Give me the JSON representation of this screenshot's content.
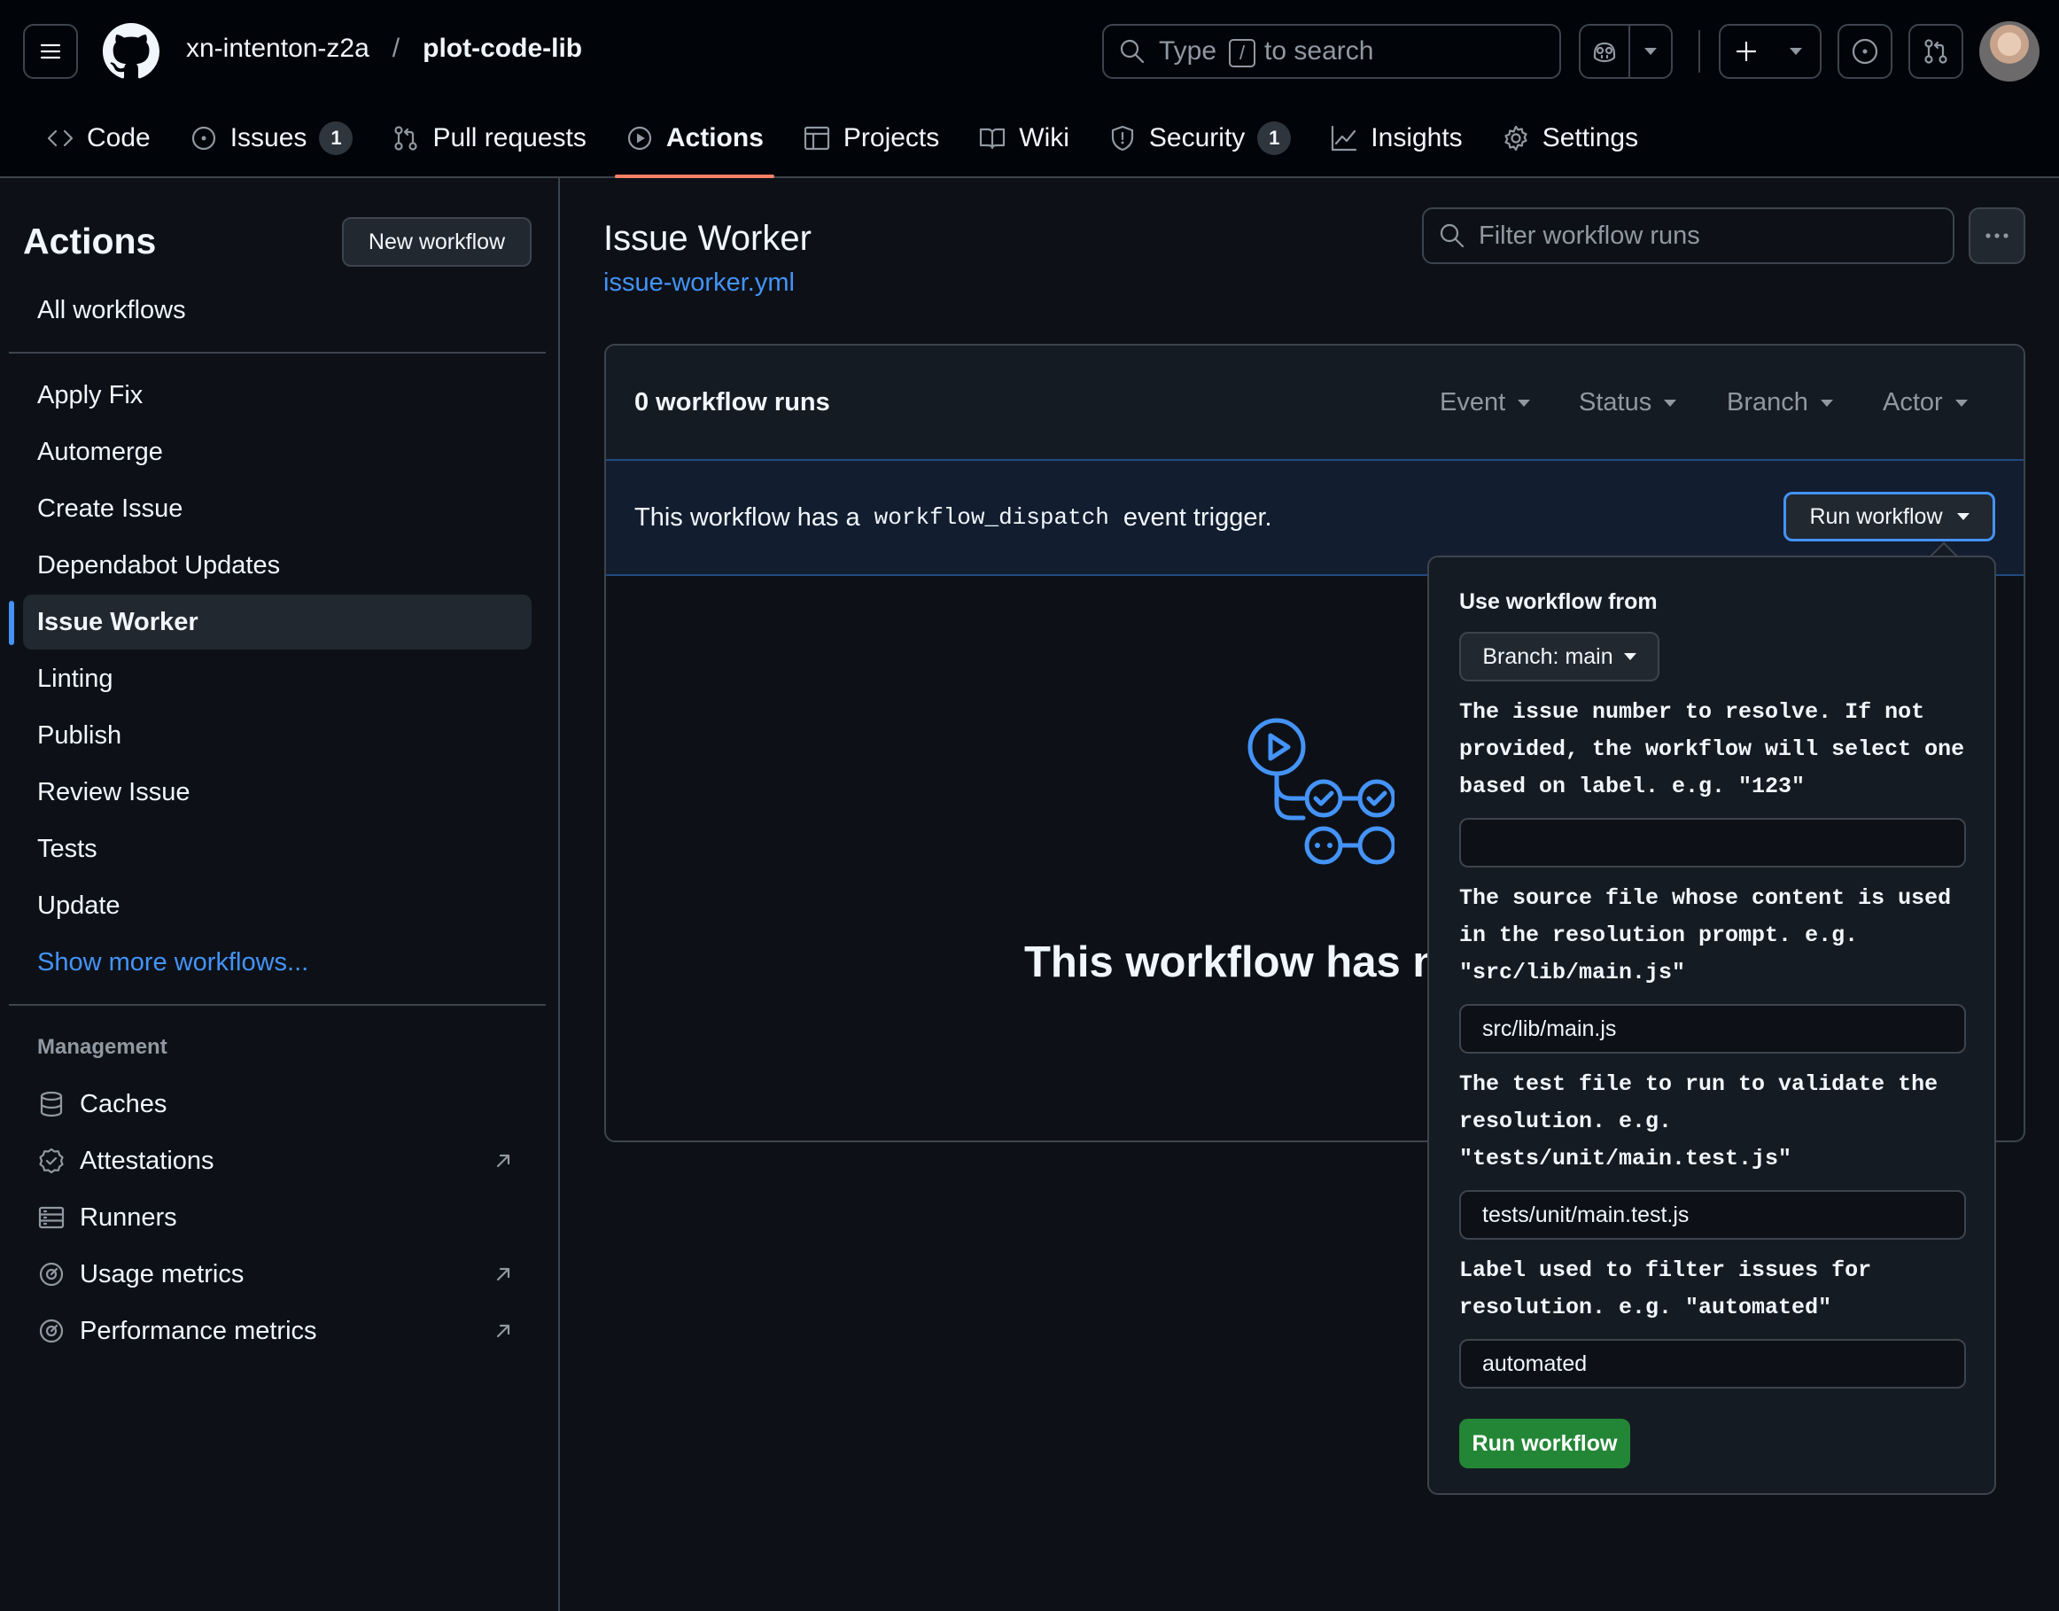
{
  "header": {
    "owner": "xn-intenton-z2a",
    "separator": "/",
    "repo": "plot-code-lib",
    "search": {
      "prefix": "Type",
      "key": "/",
      "suffix": "to search"
    }
  },
  "tabs": [
    {
      "label": "Code"
    },
    {
      "label": "Issues",
      "count": "1"
    },
    {
      "label": "Pull requests"
    },
    {
      "label": "Actions",
      "selected": true
    },
    {
      "label": "Projects"
    },
    {
      "label": "Wiki"
    },
    {
      "label": "Security",
      "count": "1"
    },
    {
      "label": "Insights"
    },
    {
      "label": "Settings"
    }
  ],
  "sidebar": {
    "title": "Actions",
    "new_workflow": "New workflow",
    "all_workflows": "All workflows",
    "workflows": [
      "Apply Fix",
      "Automerge",
      "Create Issue",
      "Dependabot Updates",
      "Issue Worker",
      "Linting",
      "Publish",
      "Review Issue",
      "Tests",
      "Update"
    ],
    "selected": "Issue Worker",
    "show_more": "Show more workflows...",
    "management_title": "Management",
    "management": [
      {
        "label": "Caches",
        "icon": "database-icon"
      },
      {
        "label": "Attestations",
        "icon": "verified-icon",
        "external": true
      },
      {
        "label": "Runners",
        "icon": "server-icon"
      },
      {
        "label": "Usage metrics",
        "icon": "meter-icon",
        "external": true
      },
      {
        "label": "Performance metrics",
        "icon": "meter-icon",
        "external": true
      }
    ]
  },
  "main": {
    "title": "Issue Worker",
    "file": "issue-worker.yml",
    "filter_placeholder": "Filter workflow runs",
    "runs_count": "0 workflow runs",
    "filters": [
      "Event",
      "Status",
      "Branch",
      "Actor"
    ],
    "dispatch_prefix": "This workflow has a",
    "dispatch_code": "workflow_dispatch",
    "dispatch_suffix": "event trigger.",
    "run_button": "Run workflow",
    "empty_text": "This workflow has no"
  },
  "panel": {
    "use_from": "Use workflow from",
    "branch": "Branch: main",
    "inputs": [
      {
        "label": "The issue number to resolve. If not provided, the workflow will select one based on label. e.g. \"123\"",
        "value": ""
      },
      {
        "label": "The source file whose content is used in the resolution prompt. e.g. \"src/lib/main.js\"",
        "value": "src/lib/main.js"
      },
      {
        "label": "The test file to run to validate the resolution. e.g. \"tests/unit/main.test.js\"",
        "value": "tests/unit/main.test.js"
      },
      {
        "label": "Label used to filter issues for resolution. e.g. \"automated\"",
        "value": "automated"
      }
    ],
    "submit": "Run workflow"
  },
  "colors": {
    "accent": "#4493f8",
    "tab_underline": "#f78166",
    "run_green": "#238636"
  }
}
